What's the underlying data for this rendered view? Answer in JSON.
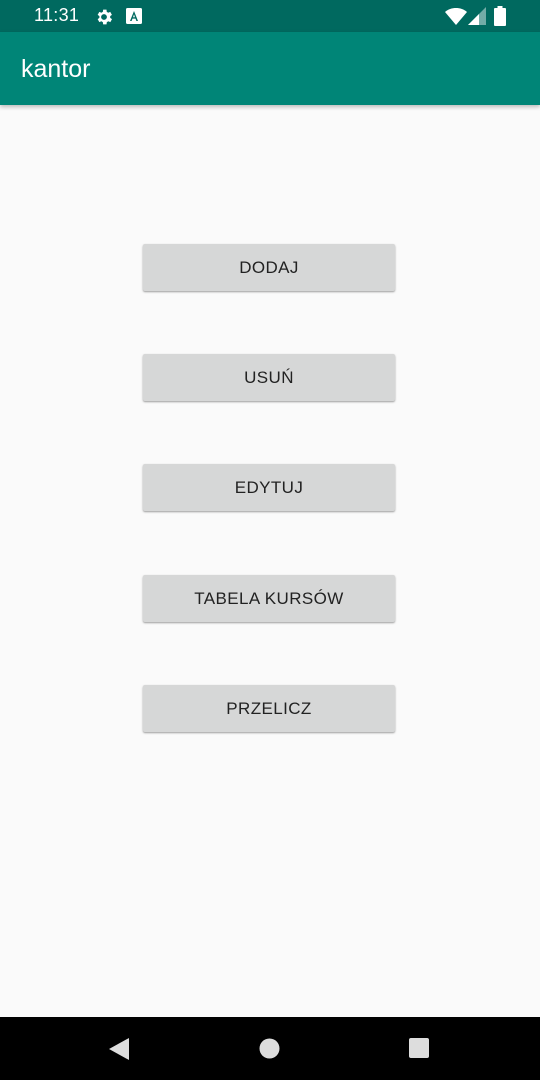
{
  "status_bar": {
    "time": "11:31",
    "icons": [
      "gear-icon",
      "a-box-icon",
      "wifi-icon",
      "signal-icon",
      "battery-icon"
    ]
  },
  "app_bar": {
    "title": "kantor",
    "color": "#008577"
  },
  "buttons": [
    {
      "label": "DODAJ"
    },
    {
      "label": "USUŃ"
    },
    {
      "label": "EDYTUJ"
    },
    {
      "label": "TABELA KURSÓW"
    },
    {
      "label": "PRZELICZ"
    }
  ],
  "nav_bar": {
    "icons": [
      "back-icon",
      "home-icon",
      "recents-icon"
    ]
  }
}
